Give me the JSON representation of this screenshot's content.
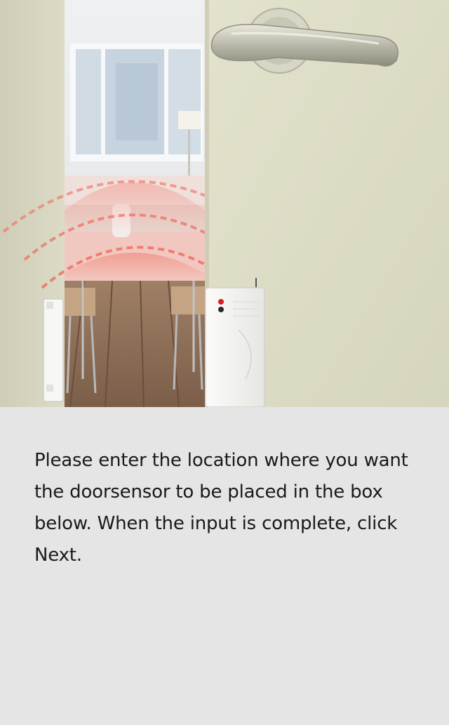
{
  "illustration": {
    "icon": "door-sensor-illustration",
    "colors": {
      "wall": "#d6d5c0",
      "door": "#deddc6",
      "signal": "#f06a5c",
      "sensor_body": "#f6f6f4",
      "led": "#d81e1e"
    }
  },
  "instruction": {
    "text": "Please enter the location where you want the doorsensor to be placed in the box below. When the input is complete, click Next."
  }
}
